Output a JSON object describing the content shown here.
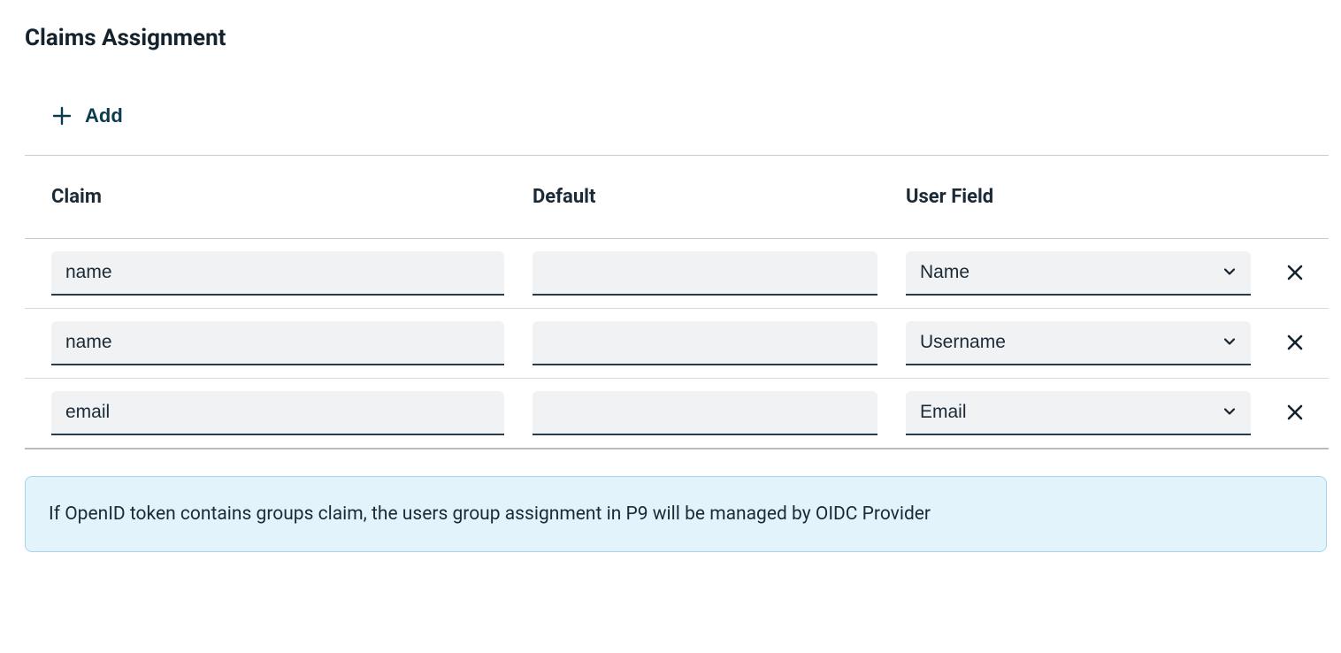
{
  "section": {
    "title": "Claims Assignment"
  },
  "actions": {
    "add_label": "Add"
  },
  "table": {
    "headers": {
      "claim": "Claim",
      "default": "Default",
      "user_field": "User Field"
    },
    "rows": [
      {
        "claim": "name",
        "default": "",
        "user_field": "Name"
      },
      {
        "claim": "name",
        "default": "",
        "user_field": "Username"
      },
      {
        "claim": "email",
        "default": "",
        "user_field": "Email"
      }
    ]
  },
  "info": {
    "text": "If OpenID token contains groups claim, the users group assignment in P9 will be managed by OIDC Provider"
  }
}
